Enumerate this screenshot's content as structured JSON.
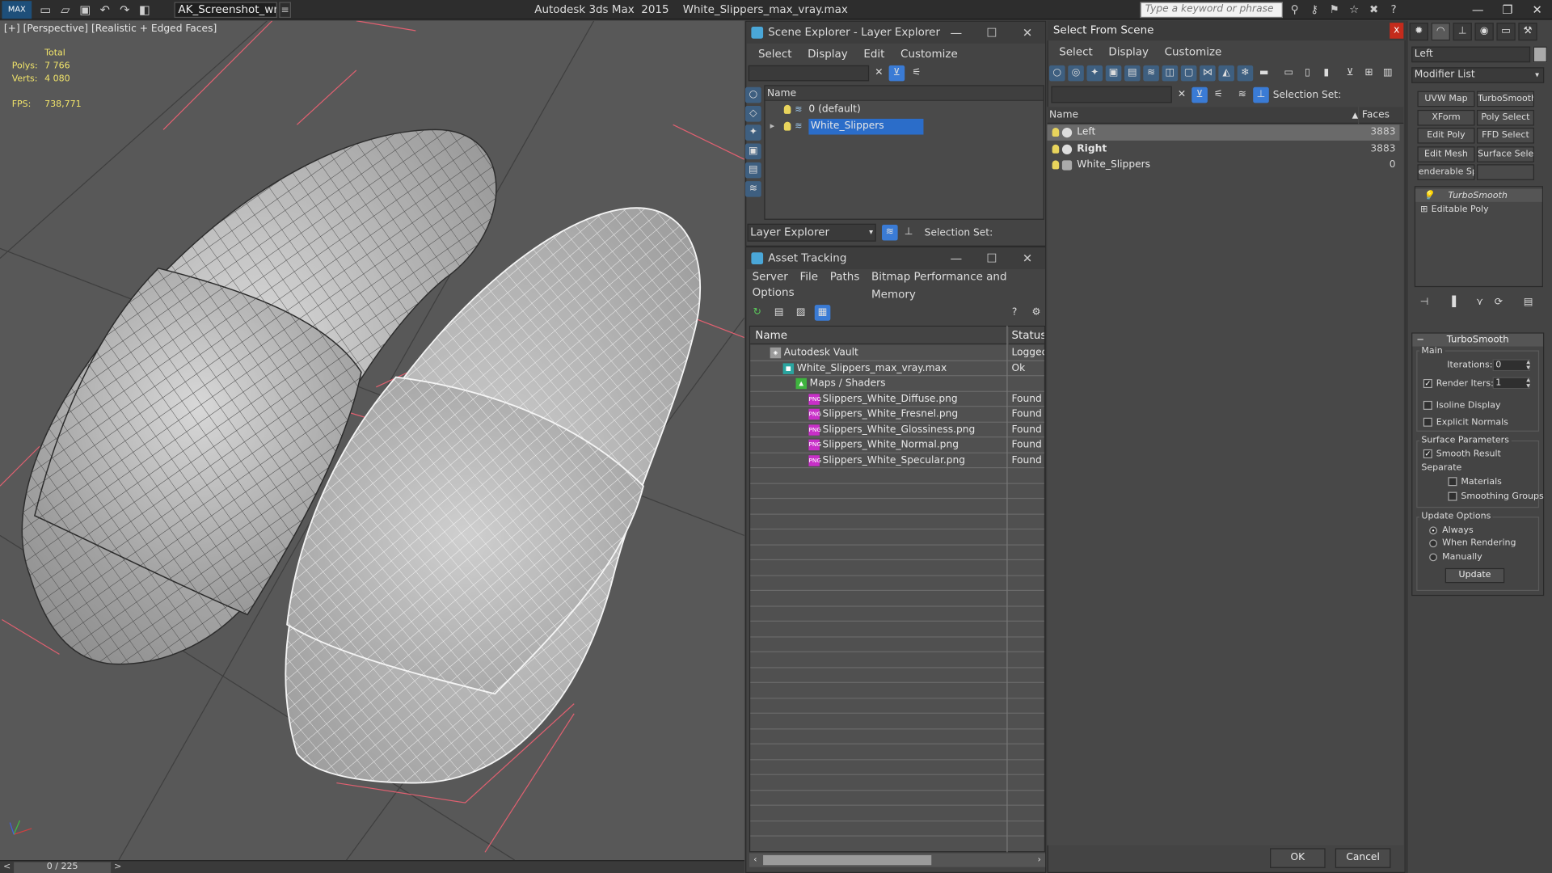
{
  "app": {
    "logo": "MAX",
    "workspace": "AK_Screenshot_wrksp",
    "product": "Autodesk 3ds Max  2015",
    "file": "White_Slippers_max_vray.max",
    "search_placeholder": "Type a keyword or phrase",
    "window_controls": [
      "—",
      "❐",
      "✕"
    ]
  },
  "viewport": {
    "label": "[+] [Perspective] [Realistic + Edged Faces]",
    "stats": {
      "total_label": "Total",
      "polys_label": "Polys:",
      "polys": "7 766",
      "verts_label": "Verts:",
      "verts": "4 080",
      "fps_label": "FPS:",
      "fps": "738,771"
    },
    "timeslider": {
      "frame": "0 / 225",
      "prev": "<",
      "next": ">"
    }
  },
  "scene_explorer": {
    "title": "Scene Explorer - Layer Explorer",
    "menu": [
      "Select",
      "Display",
      "Edit",
      "Customize"
    ],
    "column": "Name",
    "rows": [
      {
        "name": "0 (default)",
        "selected": false
      },
      {
        "name": "White_Slippers",
        "selected": true
      }
    ],
    "layer_mode": "Layer Explorer",
    "selection_set_label": "Selection Set:"
  },
  "asset_tracking": {
    "title": "Asset Tracking",
    "menu": [
      "Server",
      "File",
      "Paths",
      "Bitmap Performance and Memory",
      "Options"
    ],
    "columns": {
      "name": "Name",
      "status": "Status"
    },
    "rows": [
      {
        "name": "Autodesk Vault",
        "status": "Logged",
        "indent": 0,
        "icon": "vault-icon"
      },
      {
        "name": "White_Slippers_max_vray.max",
        "status": "Ok",
        "indent": 1,
        "icon": "max-file-icon"
      },
      {
        "name": "Maps / Shaders",
        "status": "",
        "indent": 2,
        "icon": "maps-icon"
      },
      {
        "name": "Slippers_White_Diffuse.png",
        "status": "Found",
        "indent": 3,
        "icon": "png-icon"
      },
      {
        "name": "Slippers_White_Fresnel.png",
        "status": "Found",
        "indent": 3,
        "icon": "png-icon"
      },
      {
        "name": "Slippers_White_Glossiness.png",
        "status": "Found",
        "indent": 3,
        "icon": "png-icon"
      },
      {
        "name": "Slippers_White_Normal.png",
        "status": "Found",
        "indent": 3,
        "icon": "png-icon"
      },
      {
        "name": "Slippers_White_Specular.png",
        "status": "Found",
        "indent": 3,
        "icon": "png-icon"
      }
    ]
  },
  "select_from_scene": {
    "title": "Select From Scene",
    "close": "x",
    "menu": [
      "Select",
      "Display",
      "Customize"
    ],
    "selection_set_label": "Selection Set:",
    "columns": {
      "name": "Name",
      "faces": "Faces"
    },
    "rows": [
      {
        "name": "Left",
        "faces": "3883",
        "selected": true
      },
      {
        "name": "Right",
        "faces": "3883",
        "selected": false
      },
      {
        "name": "White_Slippers",
        "faces": "0",
        "selected": false
      }
    ],
    "ok": "OK",
    "cancel": "Cancel"
  },
  "command_panel": {
    "object_name": "Left",
    "modifier_list": "Modifier List",
    "modifier_buttons": [
      "UVW Map",
      "TurboSmooth",
      "XForm",
      "Poly Select",
      "Edit Poly",
      "FFD Select",
      "Edit Mesh",
      "Surface Select",
      "enderable Splir",
      ""
    ],
    "stack": [
      "TurboSmooth",
      "Editable Poly"
    ],
    "rollout": {
      "title": "TurboSmooth",
      "main_label": "Main",
      "iterations_label": "Iterations:",
      "iterations": "0",
      "render_iters_label": "Render Iters:",
      "render_iters": "1",
      "isoline_label": "Isoline Display",
      "explicit_label": "Explicit Normals",
      "surface_label": "Surface Parameters",
      "smooth_label": "Smooth Result",
      "separate_label": "Separate",
      "materials_label": "Materials",
      "smoothing_label": "Smoothing Groups",
      "update_options_label": "Update Options",
      "always_label": "Always",
      "when_rendering_label": "When Rendering",
      "manually_label": "Manually",
      "update_button": "Update"
    }
  },
  "colors": {
    "selection": "#2b6dc9",
    "stats_text": "#f1e46a",
    "grid_line": "#e06070",
    "close_red": "#c42b1c"
  }
}
